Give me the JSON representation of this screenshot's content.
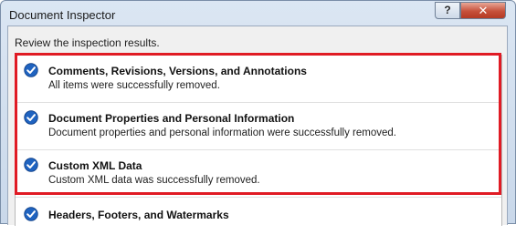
{
  "window": {
    "title": "Document Inspector",
    "help_label": "?",
    "close_label": "✕"
  },
  "subtitle": "Review the inspection results.",
  "results": [
    {
      "title": "Comments, Revisions, Versions, and Annotations",
      "description": "All items were successfully removed.",
      "status_icon": "check-circle-icon"
    },
    {
      "title": "Document Properties and Personal Information",
      "description": "Document properties and personal information were successfully removed.",
      "status_icon": "check-circle-icon"
    },
    {
      "title": "Custom XML Data",
      "description": "Custom XML data was successfully removed.",
      "status_icon": "check-circle-icon"
    },
    {
      "title": "Headers, Footers, and Watermarks",
      "description": "",
      "status_icon": "check-circle-icon"
    }
  ],
  "colors": {
    "highlight": "#e01b24",
    "check_blue": "#1f63c0"
  }
}
